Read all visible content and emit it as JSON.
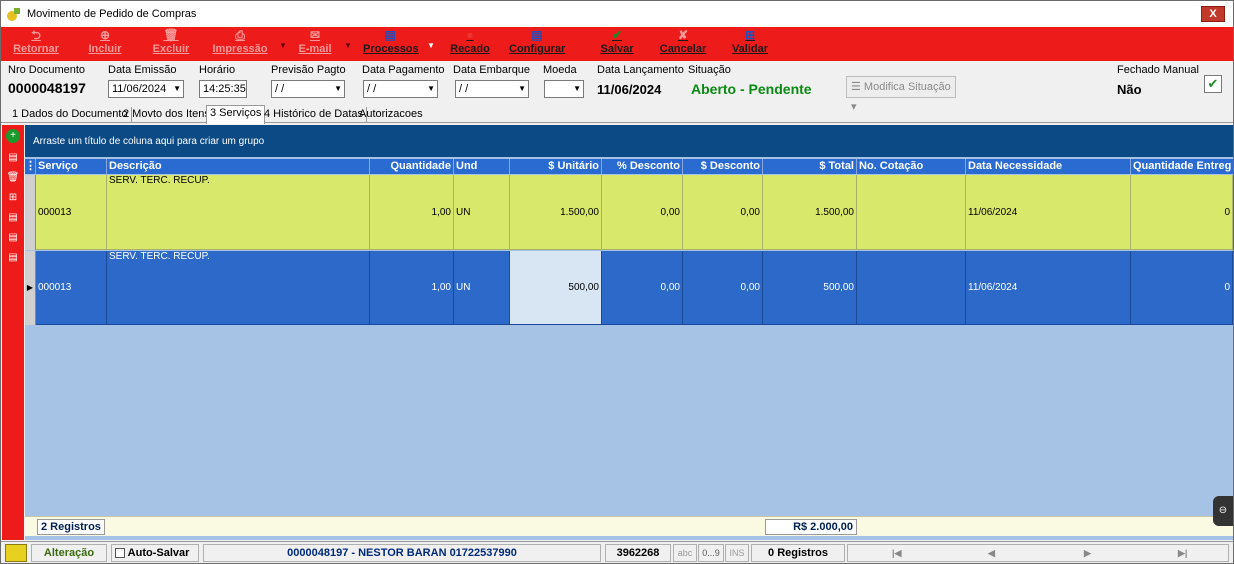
{
  "window": {
    "title": "Movimento de Pedido de Compras",
    "close_label": "X"
  },
  "toolbar": {
    "retornar": "Retornar",
    "incluir": "Incluir",
    "excluir": "Excluir",
    "impressao": "Impressão",
    "email": "E-mail",
    "processos": "Processos",
    "recado": "Recado",
    "configurar": "Configurar",
    "salvar": "Salvar",
    "cancelar": "Cancelar",
    "validar": "Validar"
  },
  "fields": {
    "nro_label": "Nro Documento",
    "nro_value": "0000048197",
    "emissao_label": "Data Emissão",
    "emissao_value": "11/06/2024",
    "horario_label": "Horário",
    "horario_value": "14:25:35",
    "previsao_label": "Previsão Pagto",
    "previsao_value": " / /",
    "pagamento_label": "Data Pagamento",
    "pagamento_value": " / /",
    "embarque_label": "Data Embarque",
    "embarque_value": " / /",
    "moeda_label": "Moeda",
    "moeda_value": "",
    "lancamento_label": "Data Lançamento",
    "lancamento_value": "11/06/2024",
    "situacao_label": "Situação",
    "situacao_value": "Aberto - Pendente",
    "modifica_label": "Modifica Situação",
    "fechado_label": "Fechado Manual",
    "fechado_value": "Não"
  },
  "tabs": [
    {
      "label": "1 Dados do Documento"
    },
    {
      "label": "2 Movto dos Itens"
    },
    {
      "label": "3 Serviços"
    },
    {
      "label": "4 Histórico de Datas"
    },
    {
      "label": "Autorizacoes"
    }
  ],
  "grid": {
    "group_hint": "Arraste um título de coluna aqui para criar um grupo",
    "columns": [
      "Serviço",
      "Descrição",
      "Quantidade",
      "Und",
      "$ Unitário",
      "% Desconto",
      "$ Desconto",
      "$ Total",
      "No. Cotação",
      "Data Necessidade",
      "Quantidade Entreg"
    ],
    "rows": [
      {
        "servico": "000013",
        "descricao": "SERV. TERC. RECUP.",
        "quantidade": "1,00",
        "und": "UN",
        "unitario": "1.500,00",
        "pdesconto": "0,00",
        "vdesconto": "0,00",
        "total": "1.500,00",
        "cotacao": "",
        "necessidade": "11/06/2024",
        "entregue": "0"
      },
      {
        "servico": "000013",
        "descricao": "SERV. TERC. RECUP.",
        "quantidade": "1,00",
        "und": "UN",
        "unitario": "500,00",
        "pdesconto": "0,00",
        "vdesconto": "0,00",
        "total": "500,00",
        "cotacao": "",
        "necessidade": "11/06/2024",
        "entregue": "0"
      }
    ],
    "footer_count": "2 Registros",
    "footer_total": "R$ 2.000,00"
  },
  "statusbar": {
    "mode": "Alteração",
    "autosave": "Auto-Salvar",
    "doc_info": "0000048197 - NESTOR BARAN 01722537990",
    "code": "3962268",
    "abc": "abc",
    "num": "0...9",
    "ins": "INS",
    "records": "0 Registros"
  },
  "colors": {
    "toolbar_red": "#ee1b1b",
    "header_blue": "#2a6bd1",
    "row_yellow": "#d8e86a",
    "row_selected": "#2d69c8",
    "status_green": "#0a8a14"
  }
}
